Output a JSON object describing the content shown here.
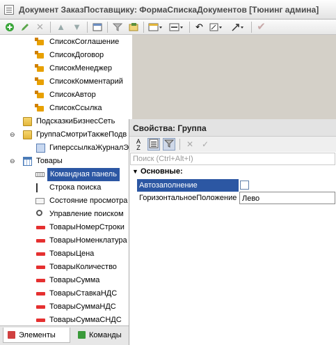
{
  "window": {
    "title": "Документ ЗаказПоставщику: ФормаСпискаДокументов [Тюнинг админа]"
  },
  "toolbar": {
    "icons": [
      "add-icon",
      "edit-icon",
      "delete-icon",
      "move-up-icon",
      "move-down-icon",
      "panel-icon",
      "filter-icon",
      "generate-icon",
      "layout-icon",
      "layout2-icon",
      "undo-icon",
      "zoom-icon",
      "expand-icon",
      "check-icon"
    ]
  },
  "tree": {
    "items": [
      {
        "label": "СписокСоглашение",
        "icon": "list-field-icon"
      },
      {
        "label": "СписокДоговор",
        "icon": "list-field-icon"
      },
      {
        "label": "СписокМенеджер",
        "icon": "list-field-icon"
      },
      {
        "label": "СписокКомментарий",
        "icon": "list-field-icon"
      },
      {
        "label": "СписокАвтор",
        "icon": "list-field-icon"
      },
      {
        "label": "СписокСсылка",
        "icon": "list-field-icon"
      },
      {
        "label": "ПодсказкиБизнесСеть",
        "icon": "folder-icon"
      },
      {
        "label": "ГруппаСмотриТакжеПодв",
        "icon": "folder-icon"
      },
      {
        "label": "ГиперссылкаЖурналЭ",
        "icon": "hyperlink-icon"
      },
      {
        "label": "Товары",
        "icon": "table-icon"
      },
      {
        "label": "Командная панель",
        "icon": "command-panel-icon"
      },
      {
        "label": "Строка поиска",
        "icon": "search-string-icon"
      },
      {
        "label": "Состояние просмотра",
        "icon": "view-state-icon"
      },
      {
        "label": "Управление поиском",
        "icon": "search-control-icon"
      },
      {
        "label": "ТоварыНомерСтроки",
        "icon": "field-icon"
      },
      {
        "label": "ТоварыНоменклатура",
        "icon": "field-icon"
      },
      {
        "label": "ТоварыЦена",
        "icon": "field-icon"
      },
      {
        "label": "ТоварыКоличество",
        "icon": "field-icon"
      },
      {
        "label": "ТоварыСумма",
        "icon": "field-icon"
      },
      {
        "label": "ТоварыСтавкаНДС",
        "icon": "field-icon"
      },
      {
        "label": "ТоварыСуммаНДС",
        "icon": "field-icon"
      },
      {
        "label": "ТоварыСуммаСНДС",
        "icon": "field-icon"
      }
    ]
  },
  "tabs": [
    {
      "label": "Элементы",
      "active": true
    },
    {
      "label": "Команды",
      "active": false
    }
  ],
  "properties": {
    "title": "Свойства: Группа",
    "search_placeholder": "Поиск (Ctrl+Alt+I)",
    "group_label": "Основные:",
    "rows": [
      {
        "name": "Автозаполнение",
        "value": "",
        "type": "checkbox",
        "checked": false
      },
      {
        "name": "ГоризонтальноеПоложение",
        "value": "Лево",
        "type": "text"
      }
    ]
  },
  "colors": {
    "selection": "#2c57a3",
    "field_icon": "#e53030",
    "list_icon": "#e8a000"
  }
}
